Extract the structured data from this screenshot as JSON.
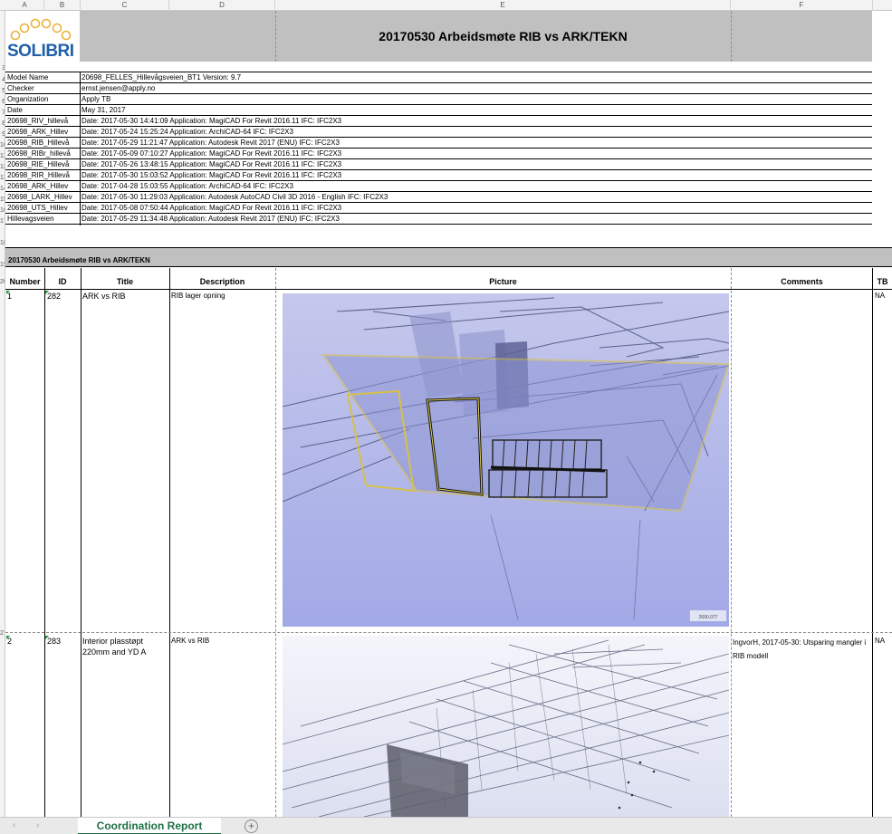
{
  "columns": {
    "headers": [
      "A",
      "B",
      "C",
      "D",
      "E",
      "F"
    ]
  },
  "rows": {
    "numbers": [
      "1",
      "2",
      "3",
      "4",
      "5",
      "6",
      "7",
      "8",
      "9",
      "10",
      "11",
      "12",
      "13",
      "14",
      "15",
      "16",
      "17",
      "18",
      "19",
      "20",
      "21"
    ]
  },
  "header": {
    "logo_text": "SOLIBRI",
    "title": "20170530 Arbeidsmøte RIB vs ARK/TEKN"
  },
  "info": [
    {
      "key": "Model Name",
      "value": "20698_FELLES_Hillevågsveien_BT1 Version: 9.7"
    },
    {
      "key": "Checker",
      "value": "ernst.jensen@apply.no"
    },
    {
      "key": "Organization",
      "value": "Apply TB"
    },
    {
      "key": "Date",
      "value": "May 31, 2017"
    },
    {
      "key": "20698_RIV_hillevå",
      "value": "Date: 2017-05-30 14:41:09 Application: MagiCAD For Revit 2016.11 IFC: IFC2X3"
    },
    {
      "key": "20698_ARK_Hillev",
      "value": "Date: 2017-05-24 15:25:24 Application: ArchiCAD-64 IFC: IFC2X3"
    },
    {
      "key": "20698_RIB_Hillevå",
      "value": "Date: 2017-05-29 11:21:47 Application: Autodesk Revit 2017 (ENU) IFC: IFC2X3"
    },
    {
      "key": "20698_RIBr_hillevå",
      "value": "Date: 2017-05-09 07:10:27 Application: MagiCAD For Revit 2016.11 IFC: IFC2X3"
    },
    {
      "key": "20698_RIE_Hillevå",
      "value": "Date: 2017-05-26 13:48:15 Application: MagiCAD For Revit 2016.11 IFC: IFC2X3"
    },
    {
      "key": "20698_RIR_Hillevå",
      "value": "Date: 2017-05-30 15:03:52 Application: MagiCAD For Revit 2016.11 IFC: IFC2X3"
    },
    {
      "key": "20698_ARK_Hillev",
      "value": "Date: 2017-04-28 15:03:55 Application: ArchiCAD-64 IFC: IFC2X3"
    },
    {
      "key": "20698_LARK_Hillev",
      "value": "Date: 2017-05-30 11:29:03 Application: Autodesk AutoCAD Civil 3D 2016 - English IFC: IFC2X3"
    },
    {
      "key": "20698_UTS_Hillev",
      "value": "Date: 2017-05-08 07:50:44 Application: MagiCAD For Revit 2016.11 IFC: IFC2X3"
    },
    {
      "key": "Hillevagsveien",
      "value": "Date: 2017-05-29 11:34:48 Application: Autodesk Revit 2017 (ENU) IFC: IFC2X3"
    }
  ],
  "section": {
    "title": "20170530 Arbeidsmøte RIB vs ARK/TEKN"
  },
  "table": {
    "headers": {
      "number": "Number",
      "id": "ID",
      "title": "Title",
      "description": "Description",
      "picture": "Picture",
      "comments": "Comments",
      "tb": "TB"
    },
    "rows": [
      {
        "number": "1",
        "id": "282",
        "title": "ARK vs RIB",
        "description": "RIB lager opning",
        "comments": "",
        "tb": "NA",
        "picture_caption": "2690.077"
      },
      {
        "number": "2",
        "id": "283",
        "title": "Interior plasstøpt 220mm and YD A",
        "description": "ARK vs RIB",
        "comments": "IngvorH, 2017-05-30: Utsparing mangler i RIB modell",
        "tb": "NA"
      }
    ]
  },
  "tabs": {
    "active": "Coordination Report",
    "add_symbol": "+",
    "prev_arrow": "‹",
    "next_arrow": "›"
  },
  "colors": {
    "band_gray": "#c0c0c0",
    "logo_blue": "#1f5fa8",
    "logo_gold": "#e8b33a",
    "tab_green": "#1e7145",
    "picture_bg_1": "#a9afe3",
    "picture_bg_2": "#e9ecf7"
  }
}
